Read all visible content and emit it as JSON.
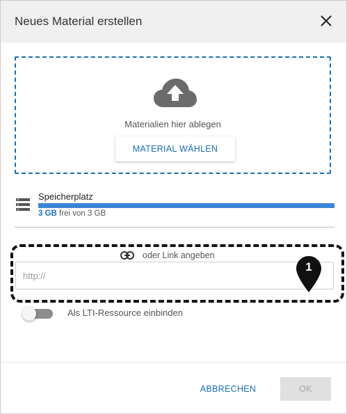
{
  "dialog": {
    "title": "Neues Material erstellen",
    "close_icon": "close-icon"
  },
  "dropzone": {
    "icon": "cloud-upload-icon",
    "text": "Materialien hier ablegen",
    "button_label": "MATERIAL WÄHLEN"
  },
  "storage": {
    "icon": "storage-stack-icon",
    "title": "Speicherplatz",
    "used": "3 GB",
    "rest": "frei von 3 GB",
    "fill_fraction": 1.0
  },
  "link": {
    "icon": "link-icon",
    "label": "oder Link angeben",
    "placeholder": "http://",
    "value": ""
  },
  "annotation": {
    "marker_number": "1",
    "icon": "map-pin-icon"
  },
  "lti": {
    "label": "Als LTI-Ressource einbinden",
    "enabled": false
  },
  "footer": {
    "cancel_label": "ABBRECHEN",
    "ok_label": "OK"
  },
  "colors": {
    "accent": "#1a6fb8",
    "progress": "#3a86d6",
    "header_bg": "#f0f0f0",
    "disabled_bg": "#e0e0e0"
  }
}
